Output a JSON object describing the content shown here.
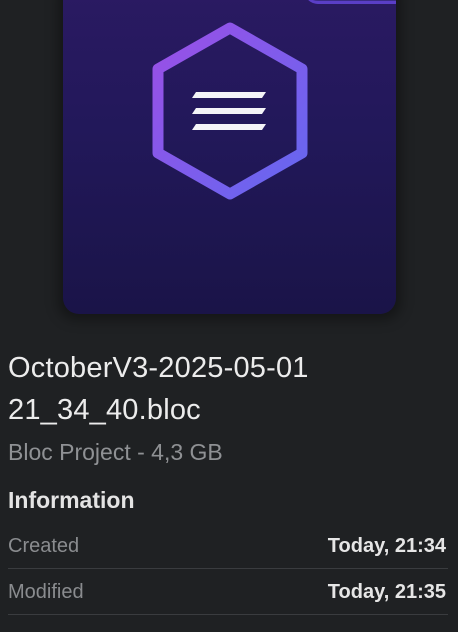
{
  "file": {
    "name_line1": "OctoberV3-2025-05-01",
    "name_line2": "21_34_40.bloc",
    "kind_and_size": "Bloc Project - 4,3 GB",
    "icon": "bloc-hexagon-icon"
  },
  "information": {
    "title": "Information",
    "rows": [
      {
        "label": "Created",
        "value": "Today, 21:34"
      },
      {
        "label": "Modified",
        "value": "Today, 21:35"
      }
    ]
  },
  "colors": {
    "background": "#1f2123",
    "doc_top": "#2b1a63",
    "doc_bottom": "#1a1448",
    "hex_stroke_start": "#8a4fe0",
    "hex_stroke_end": "#6b6cf2",
    "label": "#8a8c8f"
  }
}
